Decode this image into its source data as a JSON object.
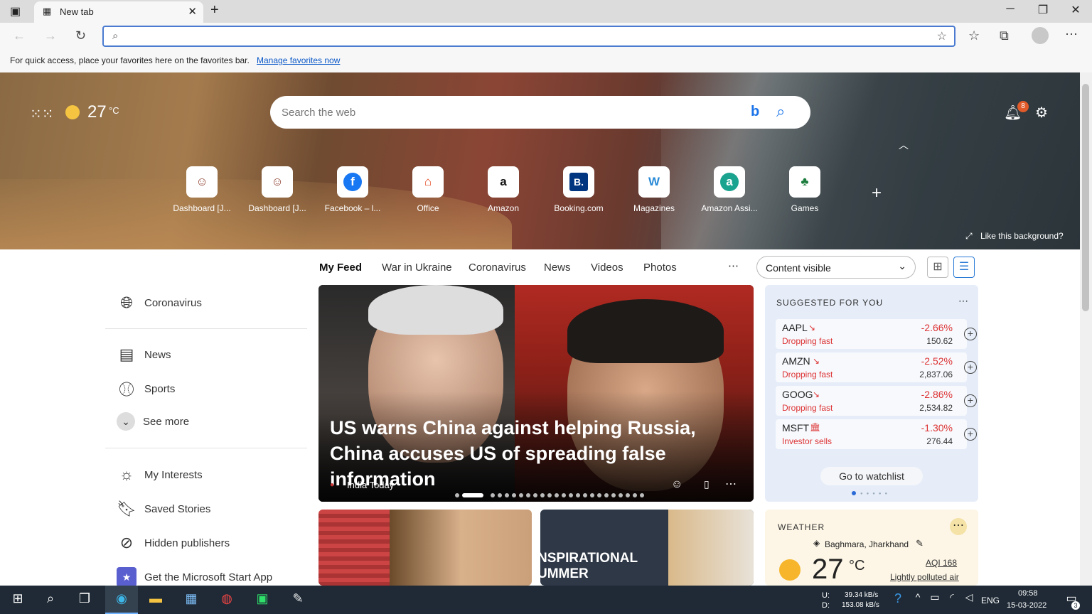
{
  "browser": {
    "tab_title": "New tab",
    "address_value": "",
    "favorites_bar_message": "For quick access, place your favorites here on the favorites bar.",
    "favorites_bar_link": "Manage favorites now"
  },
  "hero": {
    "temperature": "27",
    "temp_unit": "°C",
    "search_placeholder": "Search the web",
    "notification_count": "8",
    "like_background": "Like this background?",
    "tiles": [
      {
        "label": "Dashboard [J...",
        "icon": "jenkins-icon"
      },
      {
        "label": "Dashboard [J...",
        "icon": "jenkins-icon"
      },
      {
        "label": "Facebook – l...",
        "icon": "facebook-icon"
      },
      {
        "label": "Office",
        "icon": "office-icon"
      },
      {
        "label": "Amazon",
        "icon": "amazon-icon"
      },
      {
        "label": "Booking.com",
        "icon": "booking-icon"
      },
      {
        "label": "Magazines",
        "icon": "magazines-icon"
      },
      {
        "label": "Amazon Assi...",
        "icon": "amazon-assistant-icon"
      },
      {
        "label": "Games",
        "icon": "games-icon"
      }
    ]
  },
  "feed_nav": {
    "tabs": [
      "My Feed",
      "War in Ukraine",
      "Coronavirus",
      "News",
      "Videos",
      "Photos"
    ],
    "content_select": "Content visible"
  },
  "sidebar": {
    "items": [
      "Coronavirus",
      "News",
      "Sports",
      "See more",
      "My Interests",
      "Saved Stories",
      "Hidden publishers",
      "Get the Microsoft Start App"
    ]
  },
  "headline": {
    "title": "US warns China against helping Russia, China accuses US of spreading false information",
    "source": "India Today"
  },
  "watchlist": {
    "title": "SUGGESTED FOR YOU",
    "stocks": [
      {
        "symbol": "AAPL",
        "status": "Dropping fast",
        "change": "-2.66%",
        "price": "150.62"
      },
      {
        "symbol": "AMZN",
        "status": "Dropping fast",
        "change": "-2.52%",
        "price": "2,837.06"
      },
      {
        "symbol": "GOOG",
        "status": "Dropping fast",
        "change": "-2.86%",
        "price": "2,534.82"
      },
      {
        "symbol": "MSFT",
        "status": "Investor sells",
        "change": "-1.30%",
        "price": "276.44"
      }
    ],
    "button": "Go to watchlist"
  },
  "weather": {
    "title": "WEATHER",
    "location": "Baghmara, Jharkhand",
    "temp": "27",
    "unit": "°C",
    "aqi": "AQI 168",
    "air": "Lightly polluted air"
  },
  "small_cards": {
    "card2_text": "NSPIRATIONAL UMMER"
  },
  "taskbar": {
    "upload": "39.34 kB/s",
    "download": "153.08 kB/s",
    "upload_label": "U:",
    "download_label": "D:",
    "lang": "ENG",
    "time": "09:58",
    "date": "15-03-2022",
    "notif": "3"
  },
  "colors": {
    "accent": "#0b58c9",
    "negative": "#d33333"
  }
}
